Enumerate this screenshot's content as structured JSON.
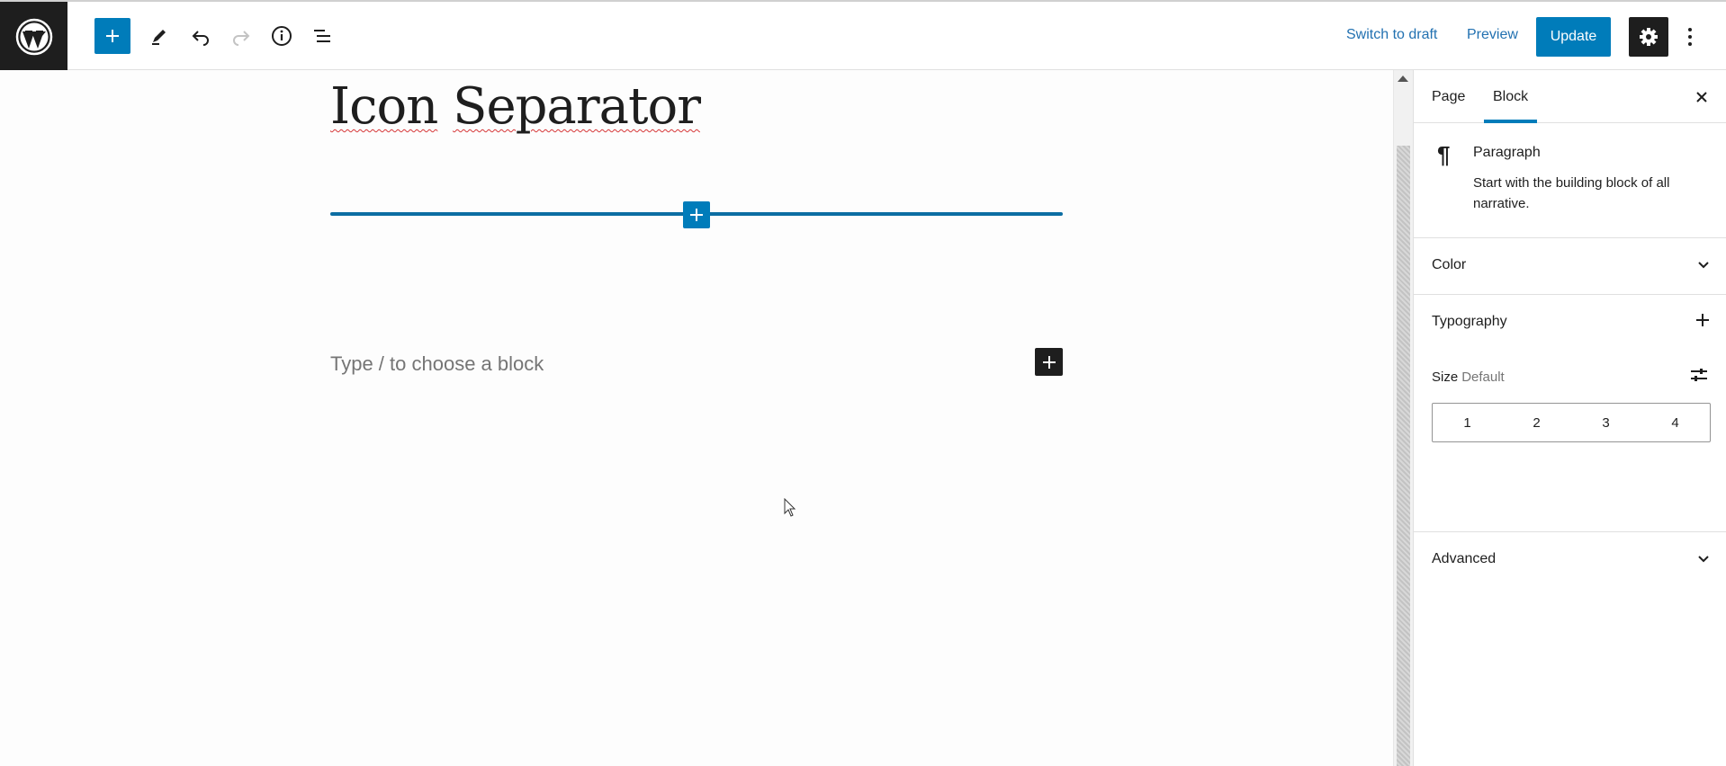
{
  "toolbar": {
    "switch_to_draft": "Switch to draft",
    "preview": "Preview",
    "update": "Update"
  },
  "editor": {
    "title_words": [
      "Icon",
      "Separator"
    ],
    "placeholder": "Type / to choose a block"
  },
  "sidebar": {
    "tabs": [
      "Page",
      "Block"
    ],
    "active_tab": "Block",
    "block": {
      "name": "Paragraph",
      "description": "Start with the building block of all narrative."
    },
    "panels": {
      "color": "Color",
      "typography": "Typography",
      "advanced": "Advanced"
    },
    "size": {
      "label": "Size",
      "value": "Default",
      "options": [
        "1",
        "2",
        "3",
        "4"
      ]
    }
  },
  "colors": {
    "accent": "#007cba",
    "dark": "#1e1e1e"
  }
}
